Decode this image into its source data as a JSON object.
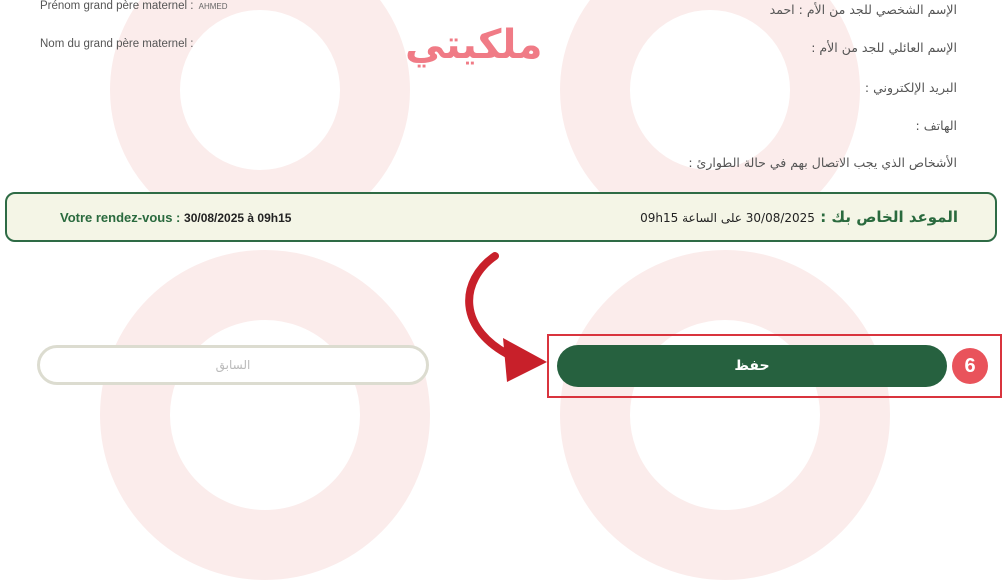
{
  "logo": "ملكيتي",
  "fields_fr": {
    "grandfather_first_name_label": "Prénom grand père maternel :",
    "grandfather_first_name_value": "AHMED",
    "grandfather_last_name_label": "Nom du grand père maternel :"
  },
  "fields_ar": {
    "grandfather_first_name": "الإسم الشخصي للجد من الأم : احمد",
    "grandfather_last_name": "الإسم العائلي للجد من الأم :",
    "email": "البريد الإلكتروني :",
    "phone": "الهاتف :",
    "emergency_contacts": "الأشخاص الذي يجب الاتصال بهم في حالة الطوارئ :"
  },
  "appointment": {
    "fr_label": "Votre rendez-vous :",
    "fr_value": "30/08/2025 à 09h15",
    "ar_label": "الموعد الخاص بك :",
    "ar_value": "30/08/2025 على الساعة 09h15"
  },
  "buttons": {
    "previous": "السابق",
    "save": "حفظ"
  },
  "step_badge": "6",
  "colors": {
    "primary_green": "#26613f",
    "highlight_red": "#d9343e",
    "logo_pink": "#f07b86"
  }
}
